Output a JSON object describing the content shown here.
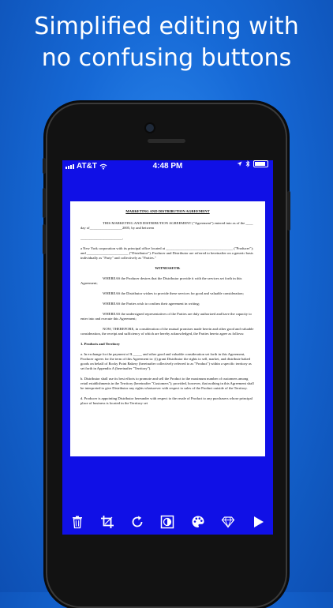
{
  "headline": {
    "line1": "Simplified editing with",
    "line2": "no confusing buttons"
  },
  "status_bar": {
    "carrier": "AT&T",
    "time": "4:48 PM"
  },
  "document": {
    "title": "MARKETING AND DISTRIBUTION AGREEMENT",
    "paragraphs": [
      "THIS MARKETING AND DISTRIBUTION AGREEMENT (\"Agreement\") entered into as of the ____ day of__________________2005, by and between",
      "_______________________,",
      "a New York corporation with its principal office located at _____________________________________ (\"Producer\"); and _______________________ (\"Distributor\"). Producer and Distributor are referred to hereinafter on a generic basis individually as \"Party\" and collectively as \"Parties.\"",
      "WITNESSETH:",
      "WHEREAS the Producer desires that the Distributor provide it with the services set forth in this Agreement;",
      "WHEREAS the Distributor wishes to provide these services for good and valuable consideration;",
      "WHEREAS the Parties wish to confirm their agreement in writing;",
      "WHEREAS the undersigned representatives of the Parties are duly authorized and have the capacity to enter into and execute this Agreement;",
      "NOW, THEREFORE, in consideration of the mutual promises made herein and other good and valuable consideration, the receipt and sufficiency of which are hereby acknowledged, the Parties hereto agree as follows:",
      "1. Products and Territory",
      "a.      In exchange for the payment of $ _____ and other good and valuable consideration set forth in this Agreement, Producer agrees for the term of this Agreement to: (i) grant Distributor the rights to sell, market, and distribute baked goods on behalf of Rocky Point Bakery (hereinafter collectively referred to as \"Product\") within a specific territory as set forth in Appendix A (hereinafter \"Territory\").",
      "b.      Distributor shall use its best efforts to promote and sell the Product to the maximum number of customers among retail establishments in the Territory (hereinafter \"Customers\"); provided, however, that nothing in this Agreement shall be interpreted to give Distributor any rights whatsoever with respect to sales of the Product outside of the Territory.",
      "d.      Producer is appointing Distributor hereunder with respect to the resale of Product to any purchasers whose principal place of business is located in the Territory set"
    ]
  },
  "toolbar": {
    "items": [
      {
        "name": "trash-icon"
      },
      {
        "name": "crop-icon"
      },
      {
        "name": "rotate-icon"
      },
      {
        "name": "contrast-icon"
      },
      {
        "name": "palette-icon"
      },
      {
        "name": "diamond-icon"
      },
      {
        "name": "play-icon"
      }
    ]
  },
  "colors": {
    "background": "#1669d6",
    "screen": "#1010e6",
    "phone_body": "#121212"
  }
}
